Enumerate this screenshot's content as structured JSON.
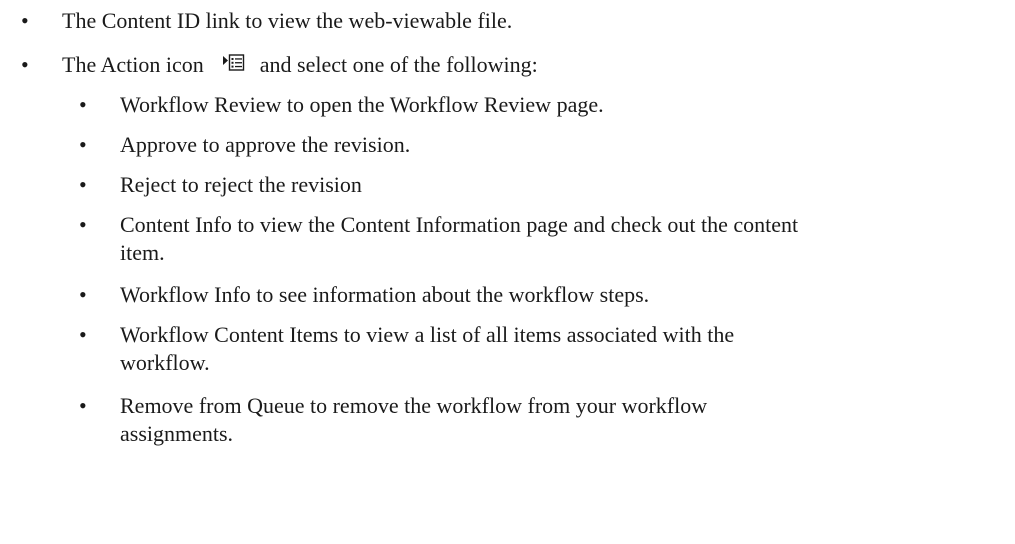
{
  "bullet_glyph": "•",
  "items": [
    {
      "text": "The Content ID link to view the web-viewable file."
    },
    {
      "text_before_icon": "The Action icon",
      "icon": "action-menu-icon",
      "text_after_icon": "and select one of the following:"
    }
  ],
  "subitems": [
    {
      "text": "Workflow Review to open the Workflow Review page."
    },
    {
      "text": "Approve to approve the revision."
    },
    {
      "text": "Reject to reject the revision"
    },
    {
      "line1": "Content Info to view the Content Information page and check out the content",
      "line2": "item."
    },
    {
      "text": "Workflow Info to see information about the workflow steps."
    },
    {
      "line1": "Workflow Content Items to view a list of all items associated with the",
      "line2": "workflow."
    },
    {
      "line1": "Remove from Queue to remove the workflow from your workflow",
      "line2": "assignments."
    }
  ]
}
